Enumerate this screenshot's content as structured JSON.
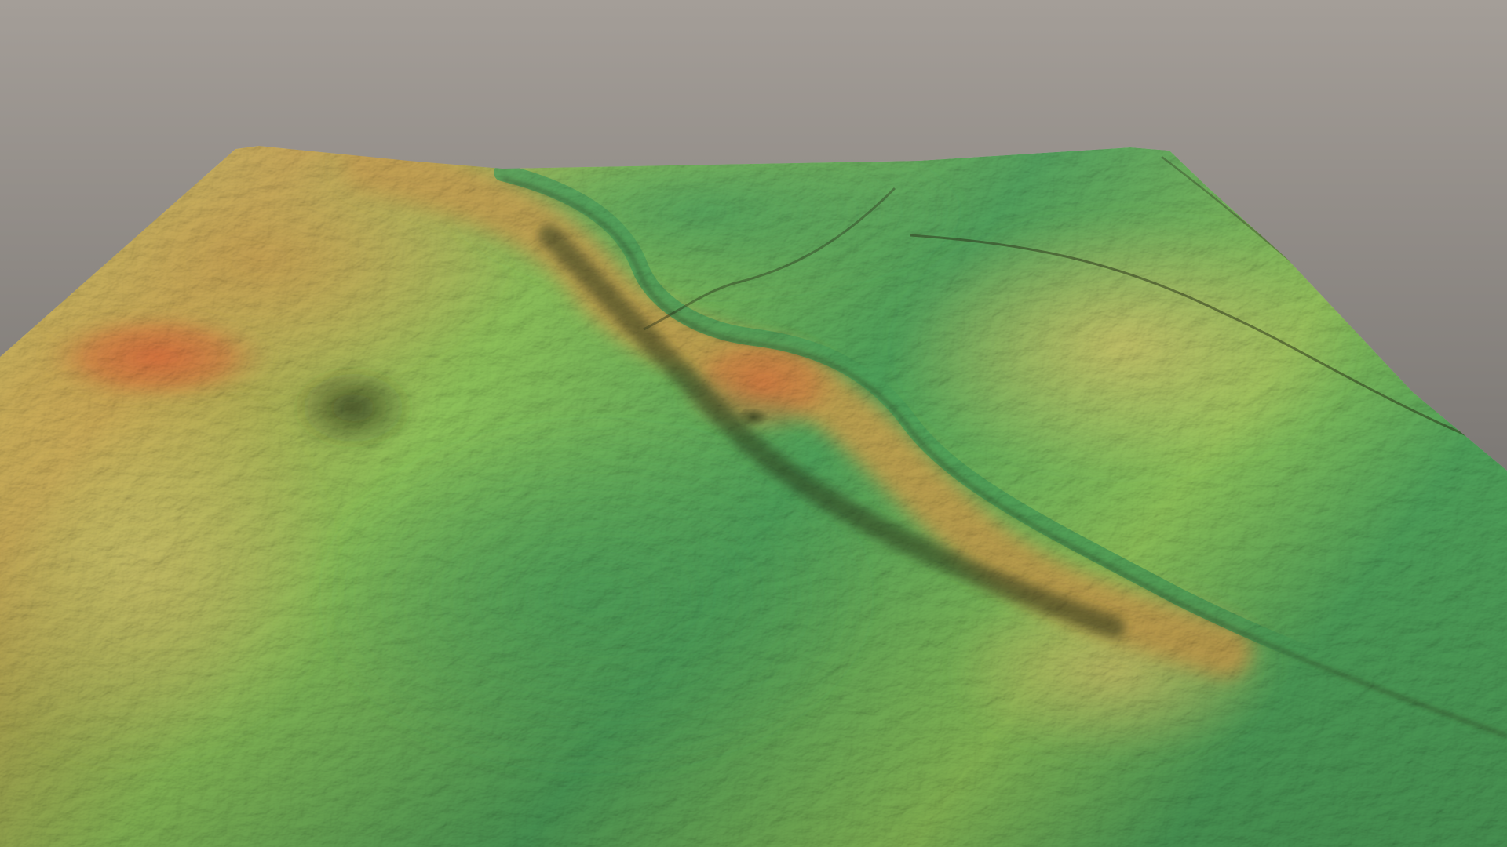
{
  "scene": {
    "background": {
      "top_color": "#a49e98",
      "bottom_color": "#5d5b59"
    },
    "elevation_palette": {
      "low": "#4fa35a",
      "mid_low": "#8fc45a",
      "mid": "#cfc56a",
      "mid_high": "#c9a250",
      "high": "#d9733e",
      "shadow": "#2f3a1c"
    }
  }
}
